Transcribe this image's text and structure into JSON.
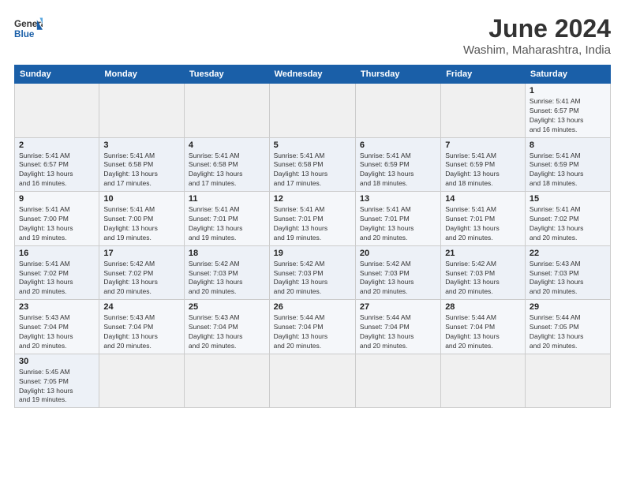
{
  "header": {
    "logo_general": "General",
    "logo_blue": "Blue",
    "month_title": "June 2024",
    "subtitle": "Washim, Maharashtra, India"
  },
  "weekdays": [
    "Sunday",
    "Monday",
    "Tuesday",
    "Wednesday",
    "Thursday",
    "Friday",
    "Saturday"
  ],
  "weeks": [
    [
      {
        "day": "",
        "info": ""
      },
      {
        "day": "",
        "info": ""
      },
      {
        "day": "",
        "info": ""
      },
      {
        "day": "",
        "info": ""
      },
      {
        "day": "",
        "info": ""
      },
      {
        "day": "",
        "info": ""
      },
      {
        "day": "1",
        "info": "Sunrise: 5:41 AM\nSunset: 6:57 PM\nDaylight: 13 hours\nand 16 minutes."
      }
    ],
    [
      {
        "day": "2",
        "info": "Sunrise: 5:41 AM\nSunset: 6:57 PM\nDaylight: 13 hours\nand 16 minutes."
      },
      {
        "day": "3",
        "info": "Sunrise: 5:41 AM\nSunset: 6:58 PM\nDaylight: 13 hours\nand 17 minutes."
      },
      {
        "day": "4",
        "info": "Sunrise: 5:41 AM\nSunset: 6:58 PM\nDaylight: 13 hours\nand 17 minutes."
      },
      {
        "day": "5",
        "info": "Sunrise: 5:41 AM\nSunset: 6:58 PM\nDaylight: 13 hours\nand 17 minutes."
      },
      {
        "day": "6",
        "info": "Sunrise: 5:41 AM\nSunset: 6:59 PM\nDaylight: 13 hours\nand 18 minutes."
      },
      {
        "day": "7",
        "info": "Sunrise: 5:41 AM\nSunset: 6:59 PM\nDaylight: 13 hours\nand 18 minutes."
      },
      {
        "day": "8",
        "info": "Sunrise: 5:41 AM\nSunset: 6:59 PM\nDaylight: 13 hours\nand 18 minutes."
      }
    ],
    [
      {
        "day": "9",
        "info": "Sunrise: 5:41 AM\nSunset: 7:00 PM\nDaylight: 13 hours\nand 19 minutes."
      },
      {
        "day": "10",
        "info": "Sunrise: 5:41 AM\nSunset: 7:00 PM\nDaylight: 13 hours\nand 19 minutes."
      },
      {
        "day": "11",
        "info": "Sunrise: 5:41 AM\nSunset: 7:01 PM\nDaylight: 13 hours\nand 19 minutes."
      },
      {
        "day": "12",
        "info": "Sunrise: 5:41 AM\nSunset: 7:01 PM\nDaylight: 13 hours\nand 19 minutes."
      },
      {
        "day": "13",
        "info": "Sunrise: 5:41 AM\nSunset: 7:01 PM\nDaylight: 13 hours\nand 20 minutes."
      },
      {
        "day": "14",
        "info": "Sunrise: 5:41 AM\nSunset: 7:01 PM\nDaylight: 13 hours\nand 20 minutes."
      },
      {
        "day": "15",
        "info": "Sunrise: 5:41 AM\nSunset: 7:02 PM\nDaylight: 13 hours\nand 20 minutes."
      }
    ],
    [
      {
        "day": "16",
        "info": "Sunrise: 5:41 AM\nSunset: 7:02 PM\nDaylight: 13 hours\nand 20 minutes."
      },
      {
        "day": "17",
        "info": "Sunrise: 5:42 AM\nSunset: 7:02 PM\nDaylight: 13 hours\nand 20 minutes."
      },
      {
        "day": "18",
        "info": "Sunrise: 5:42 AM\nSunset: 7:03 PM\nDaylight: 13 hours\nand 20 minutes."
      },
      {
        "day": "19",
        "info": "Sunrise: 5:42 AM\nSunset: 7:03 PM\nDaylight: 13 hours\nand 20 minutes."
      },
      {
        "day": "20",
        "info": "Sunrise: 5:42 AM\nSunset: 7:03 PM\nDaylight: 13 hours\nand 20 minutes."
      },
      {
        "day": "21",
        "info": "Sunrise: 5:42 AM\nSunset: 7:03 PM\nDaylight: 13 hours\nand 20 minutes."
      },
      {
        "day": "22",
        "info": "Sunrise: 5:43 AM\nSunset: 7:03 PM\nDaylight: 13 hours\nand 20 minutes."
      }
    ],
    [
      {
        "day": "23",
        "info": "Sunrise: 5:43 AM\nSunset: 7:04 PM\nDaylight: 13 hours\nand 20 minutes."
      },
      {
        "day": "24",
        "info": "Sunrise: 5:43 AM\nSunset: 7:04 PM\nDaylight: 13 hours\nand 20 minutes."
      },
      {
        "day": "25",
        "info": "Sunrise: 5:43 AM\nSunset: 7:04 PM\nDaylight: 13 hours\nand 20 minutes."
      },
      {
        "day": "26",
        "info": "Sunrise: 5:44 AM\nSunset: 7:04 PM\nDaylight: 13 hours\nand 20 minutes."
      },
      {
        "day": "27",
        "info": "Sunrise: 5:44 AM\nSunset: 7:04 PM\nDaylight: 13 hours\nand 20 minutes."
      },
      {
        "day": "28",
        "info": "Sunrise: 5:44 AM\nSunset: 7:04 PM\nDaylight: 13 hours\nand 20 minutes."
      },
      {
        "day": "29",
        "info": "Sunrise: 5:44 AM\nSunset: 7:05 PM\nDaylight: 13 hours\nand 20 minutes."
      }
    ],
    [
      {
        "day": "30",
        "info": "Sunrise: 5:45 AM\nSunset: 7:05 PM\nDaylight: 13 hours\nand 19 minutes."
      },
      {
        "day": "",
        "info": ""
      },
      {
        "day": "",
        "info": ""
      },
      {
        "day": "",
        "info": ""
      },
      {
        "day": "",
        "info": ""
      },
      {
        "day": "",
        "info": ""
      },
      {
        "day": "",
        "info": ""
      }
    ]
  ]
}
